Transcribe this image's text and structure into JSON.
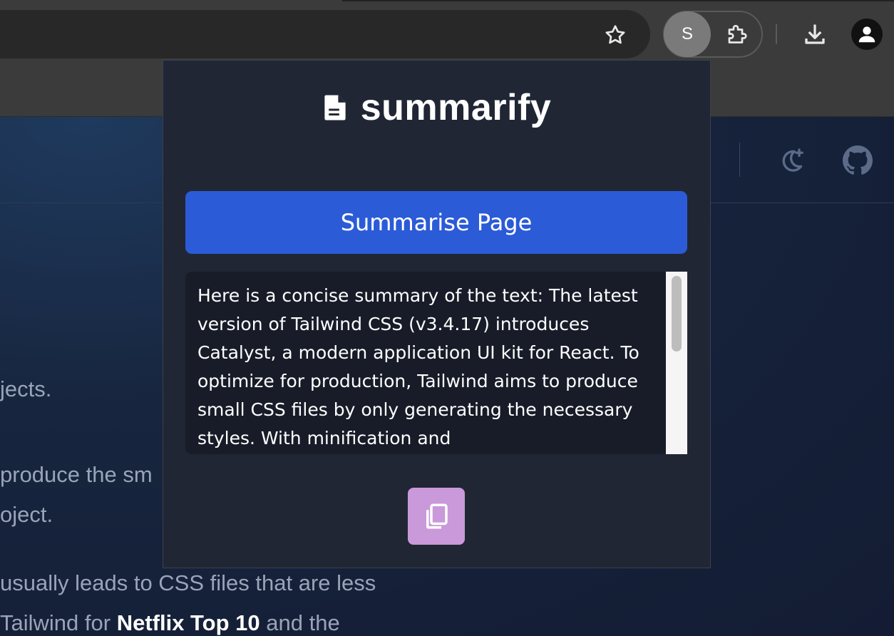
{
  "browser": {
    "extension_badge_letter": "S",
    "icons": {
      "bookmark": "star-icon",
      "extensions": "puzzle-icon",
      "downloads": "download-icon",
      "profile": "person-icon"
    }
  },
  "page": {
    "text_lines": [
      {
        "text": "jects."
      },
      {
        "text": " produce the sm"
      },
      {
        "text": "oject."
      },
      {
        "text": "usually leads to CSS files that are less"
      },
      {
        "before": " Tailwind for ",
        "bold": "Netflix Top 10",
        "after": " and the"
      }
    ],
    "icons": {
      "theme": "moon-stars-icon",
      "github": "github-icon"
    }
  },
  "popup": {
    "title": "summarify",
    "logo_icon": "document-icon",
    "summarise_button_label": "Summarise Page",
    "summary_text": "Here is a concise summary of the text: The latest version of Tailwind CSS (v3.4.17) introduces Catalyst, a modern application UI kit for React. To optimize for production, Tailwind aims to produce small CSS files by only generating the necessary styles. With minification and",
    "copy_icon": "copy-icon"
  },
  "colors": {
    "accent_button": "#2b5bd7",
    "copy_button": "#c999d9",
    "popup_bg": "#202634"
  }
}
